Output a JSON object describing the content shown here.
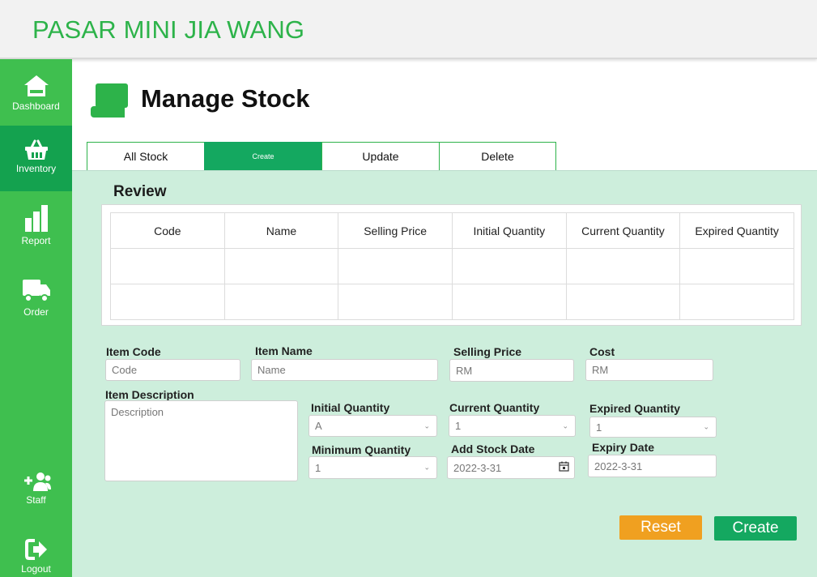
{
  "app": {
    "title": "PASAR MINI JIA WANG"
  },
  "sidebar": {
    "items": [
      {
        "label": "Dashboard",
        "icon": "home-icon"
      },
      {
        "label": "Inventory",
        "icon": "basket-icon",
        "active": true
      },
      {
        "label": "Report",
        "icon": "bar-chart-icon"
      },
      {
        "label": "Order",
        "icon": "truck-icon"
      },
      {
        "label": "Staff",
        "icon": "add-staff-icon"
      },
      {
        "label": "Logout",
        "icon": "logout-icon"
      }
    ]
  },
  "page": {
    "title": "Manage Stock",
    "icon": "scroll-icon"
  },
  "tabs": [
    "All Stock",
    "Create",
    "Update",
    "Delete"
  ],
  "review": {
    "title": "Review",
    "columns": [
      "Code",
      "Name",
      "Selling Price",
      "Initial Quantity",
      "Current Quantity",
      "Expired Quantity"
    ],
    "rows": [
      [
        "",
        "",
        "",
        "",
        "",
        ""
      ],
      [
        "",
        "",
        "",
        "",
        "",
        ""
      ]
    ]
  },
  "form": {
    "item_code": {
      "label": "Item Code",
      "placeholder": "Code"
    },
    "item_name": {
      "label": "Item Name",
      "placeholder": "Name"
    },
    "selling_price": {
      "label": "Selling Price",
      "placeholder": "RM"
    },
    "cost": {
      "label": "Cost",
      "placeholder": "RM"
    },
    "item_description": {
      "label": "Item Description",
      "placeholder": "Description"
    },
    "initial_quantity": {
      "label": "Initial Quantity",
      "value": "A"
    },
    "current_quantity": {
      "label": "Current Quantity",
      "value": "1"
    },
    "expired_quantity": {
      "label": "Expired Quantity",
      "value": "1"
    },
    "minimum_quantity": {
      "label": "Minimum Quantity",
      "value": "1"
    },
    "add_stock_date": {
      "label": "Add Stock Date",
      "value": "2022-3-31"
    },
    "expiry_date": {
      "label": "Expiry Date",
      "value": "2022-3-31"
    }
  },
  "buttons": {
    "reset": "Reset",
    "create": "Create"
  },
  "colors": {
    "brand_green": "#3fbf4f",
    "active_green": "#14a860",
    "panel_bg": "#cdeedc",
    "reset_orange": "#f0a020"
  }
}
